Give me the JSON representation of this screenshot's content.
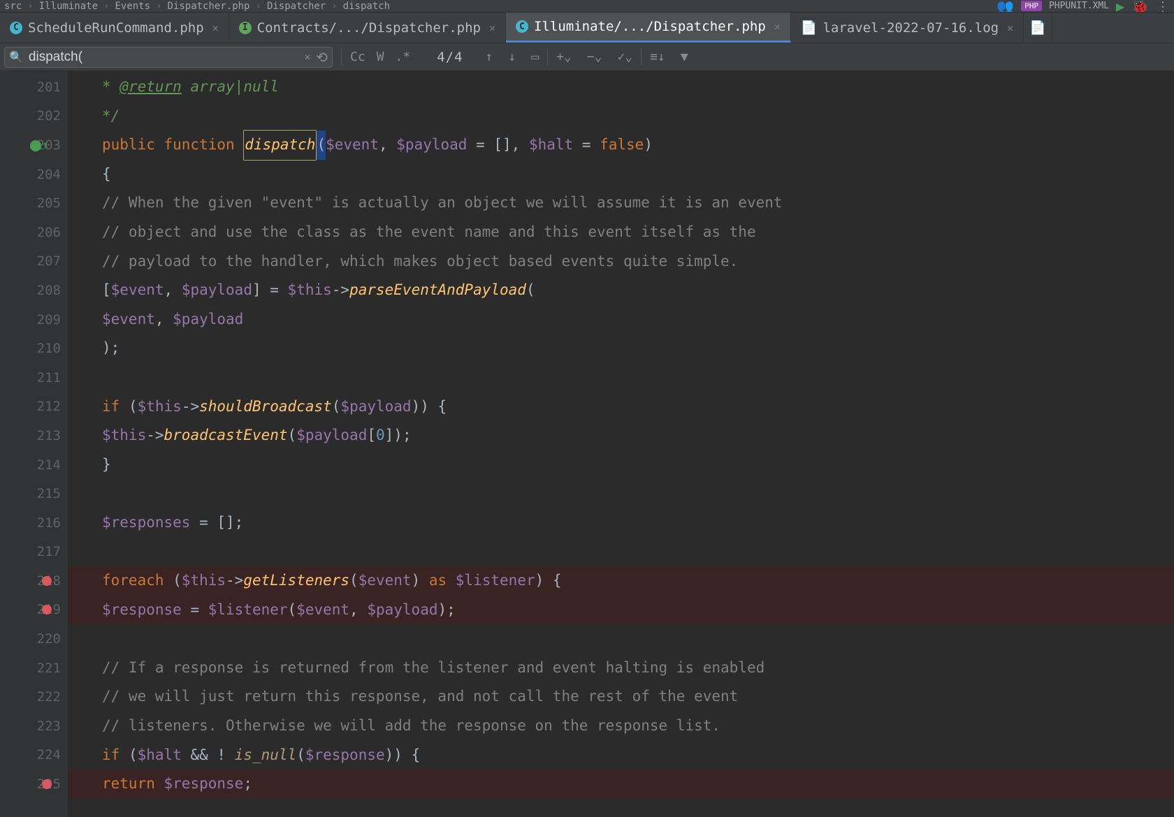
{
  "breadcrumb": [
    "src",
    "Illuminate",
    "Events",
    "Dispatcher.php",
    "Dispatcher",
    "dispatch"
  ],
  "toolbar": {
    "php_badge": "PHP",
    "run_config": "PHPUNIT.XML"
  },
  "tabs": [
    {
      "label": "ScheduleRunCommand.php",
      "icon_color": "#43b5cc",
      "icon_letter": "C",
      "active": false
    },
    {
      "label": "Contracts/.../Dispatcher.php",
      "icon_color": "#5fa55a",
      "icon_letter": "I",
      "active": false
    },
    {
      "label": "Illuminate/.../Dispatcher.php",
      "icon_color": "#43b5cc",
      "icon_letter": "C",
      "active": true
    },
    {
      "label": "laravel-2022-07-16.log",
      "icon_color": "",
      "icon_letter": "",
      "active": false,
      "is_log": true
    }
  ],
  "find": {
    "query": "dispatch(",
    "count": "4/4",
    "toggles": {
      "cc": "Cc",
      "w": "W",
      "regex": ".*"
    }
  },
  "lines": [
    {
      "n": "201",
      "html": "     <span class='doc'>* </span><span class='doctag'>@return</span><span class='doc'> array|null</span>"
    },
    {
      "n": "202",
      "html": "     <span class='doc'>*/</span>",
      "fold": true
    },
    {
      "n": "203",
      "html": "    <span class='kw'>public function </span><span class='fn-def sel-box'>dispatch</span><span class='str-hl'>(</span><span class='var'>$event</span><span class='white'>, </span><span class='var'>$payload</span><span class='white'> = [], </span><span class='var'>$halt</span><span class='white'> = </span><span class='kw'>false</span><span class='white'>)</span>",
      "marker": true,
      "fold": true
    },
    {
      "n": "204",
      "html": "    <span class='white'>{</span>"
    },
    {
      "n": "205",
      "html": "        <span class='comment'>// When the given \"event\" is actually an object we will assume it is an event</span>"
    },
    {
      "n": "206",
      "html": "        <span class='comment'>// object and use the class as the event name and this event itself as the</span>"
    },
    {
      "n": "207",
      "html": "        <span class='comment'>// payload to the handler, which makes object based events quite simple.</span>"
    },
    {
      "n": "208",
      "html": "        <span class='white'>[</span><span class='var'>$event</span><span class='white'>, </span><span class='var'>$payload</span><span class='white'>] = </span><span class='var'>$this</span><span class='white'>-></span><span class='method'>parseEventAndPayload</span><span class='white'>(</span>"
    },
    {
      "n": "209",
      "html": "            <span class='var'>$event</span><span class='white'>, </span><span class='var'>$payload</span>"
    },
    {
      "n": "210",
      "html": "        <span class='white'>);</span>",
      "fold": true
    },
    {
      "n": "211",
      "html": ""
    },
    {
      "n": "212",
      "html": "        <span class='kw'>if </span><span class='white'>(</span><span class='var'>$this</span><span class='white'>-></span><span class='method'>shouldBroadcast</span><span class='white'>(</span><span class='var'>$payload</span><span class='white'>)) {</span>",
      "fold": true
    },
    {
      "n": "213",
      "html": "            <span class='var'>$this</span><span class='white'>-></span><span class='method'>broadcastEvent</span><span class='white'>(</span><span class='var'>$payload</span><span class='white'>[</span><span class='num'>0</span><span class='white'>]);</span>"
    },
    {
      "n": "214",
      "html": "        <span class='white'>}</span>",
      "fold": true
    },
    {
      "n": "215",
      "html": ""
    },
    {
      "n": "216",
      "html": "        <span class='var'>$responses</span><span class='white'> = [];</span>"
    },
    {
      "n": "217",
      "html": ""
    },
    {
      "n": "218",
      "html": "        <span class='kw'>foreach </span><span class='white'>(</span><span class='var'>$this</span><span class='white'>-></span><span class='method'>getListeners</span><span class='white'>(</span><span class='var'>$event</span><span class='white'>) </span><span class='kw'>as </span><span class='var'>$listener</span><span class='white'>) {</span>",
      "bp": true,
      "fold": true
    },
    {
      "n": "219",
      "html": "            <span class='var'>$response</span><span class='white'> = </span><span class='var'>$listener</span><span class='white'>(</span><span class='var'>$event</span><span class='white'>, </span><span class='var'>$payload</span><span class='white'>);</span>",
      "bp": true
    },
    {
      "n": "220",
      "html": ""
    },
    {
      "n": "221",
      "html": "            <span class='comment'>// If a response is returned from the listener and event halting is enabled</span>"
    },
    {
      "n": "222",
      "html": "            <span class='comment'>// we will just return this response, and not call the rest of the event</span>"
    },
    {
      "n": "223",
      "html": "            <span class='comment'>// listeners. Otherwise we will add the response on the response list.</span>"
    },
    {
      "n": "224",
      "html": "            <span class='kw'>if </span><span class='white'>(</span><span class='var'>$halt</span><span class='white'> && ! </span><span class='method2'>is_null</span><span class='white'>(</span><span class='var'>$response</span><span class='white'>)) {</span>",
      "fold": true
    },
    {
      "n": "225",
      "html": "                <span class='kw'>return </span><span class='var'>$response</span><span class='white'>;</span>",
      "bp": true
    }
  ]
}
